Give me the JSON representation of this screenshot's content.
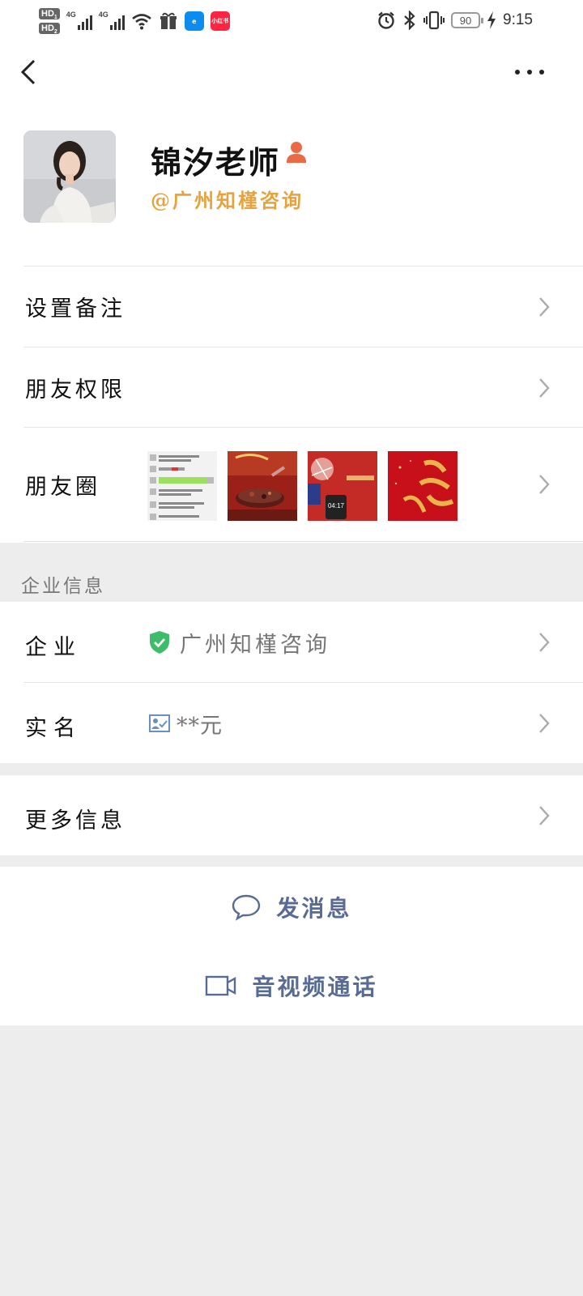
{
  "status_bar": {
    "hd1": "HD",
    "hd1_sub": "1",
    "hd2": "HD",
    "hd2_sub": "2",
    "net1": "4G",
    "net2": "4G",
    "app_badge": "小红书",
    "battery": "90",
    "time": "9:15"
  },
  "header": {
    "back_icon": "chevron-left-icon",
    "more_icon": "more-dots-icon"
  },
  "profile": {
    "name": "锦汐老师",
    "company": "@广州知槿咨询",
    "accent_color": "#e6a23c"
  },
  "rows": {
    "remark": "设置备注",
    "permissions": "朋友权限",
    "moments": "朋友圈"
  },
  "moments_thumbs": [
    {
      "caption": ""
    },
    {
      "caption": ""
    },
    {
      "caption": "04:17"
    },
    {
      "caption": ""
    }
  ],
  "enterprise": {
    "section_title": "企业信息",
    "company_label": "企业",
    "company_value": "广州知槿咨询",
    "realname_label": "实名",
    "realname_value": "**元"
  },
  "more_info": "更多信息",
  "actions": {
    "message": "发消息",
    "call": "音视频通话",
    "link_color": "#576b95"
  }
}
